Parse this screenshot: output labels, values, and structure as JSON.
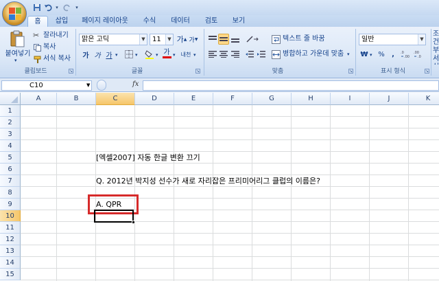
{
  "quick_access": {
    "save": "save-icon",
    "undo": "undo-icon",
    "redo": "redo-icon",
    "customize": "chevron-down-icon"
  },
  "tabs": [
    {
      "label": "홈",
      "active": true
    },
    {
      "label": "삽입"
    },
    {
      "label": "페이지 레이아웃"
    },
    {
      "label": "수식"
    },
    {
      "label": "데이터"
    },
    {
      "label": "검토"
    },
    {
      "label": "보기"
    }
  ],
  "clipboard": {
    "paste_label": "붙여넣기",
    "cut_label": "잘라내기",
    "copy_label": "복사",
    "format_painter_label": "서식 복사",
    "group_label": "클립보드"
  },
  "font": {
    "font_name": "맑은 고딕",
    "font_size": "11",
    "grow_label": "가",
    "shrink_label": "가",
    "bold_label": "가",
    "italic_label": "가",
    "underline_label": "가",
    "font_color_label": "가",
    "phonetic_label": "내천",
    "group_label": "글꼴"
  },
  "alignment": {
    "wrap_label": "텍스트 줄 바꿈",
    "merge_label": "병합하고 가운데 맞춤",
    "group_label": "맞춤"
  },
  "number": {
    "format": "일반",
    "currency": "₩",
    "percent": "%",
    "comma": ",",
    "group_label": "표시 형식"
  },
  "styles": {
    "partial_label": "조건부 서식"
  },
  "formula_bar": {
    "name_box": "C10",
    "fx": "fx",
    "value": ""
  },
  "columns": [
    "A",
    "B",
    "C",
    "D",
    "E",
    "F",
    "G",
    "H",
    "I",
    "J",
    "K"
  ],
  "rows": [
    "1",
    "2",
    "3",
    "4",
    "5",
    "6",
    "7",
    "8",
    "9",
    "10",
    "11",
    "12",
    "13",
    "14",
    "15"
  ],
  "cells": {
    "C5": "[엑셀2007] 자동 한글 변환 끄기",
    "C7": "Q. 2012년 박지성 선수가 새로 자리잡은 프리미어리그 클럽의 이름은?",
    "C9": "A. QPR"
  },
  "active_cell": "C10",
  "colors": {
    "highlight_box": "#d62a2a",
    "selected_header": "#f9d38a",
    "ribbon": "#dce8f7"
  }
}
